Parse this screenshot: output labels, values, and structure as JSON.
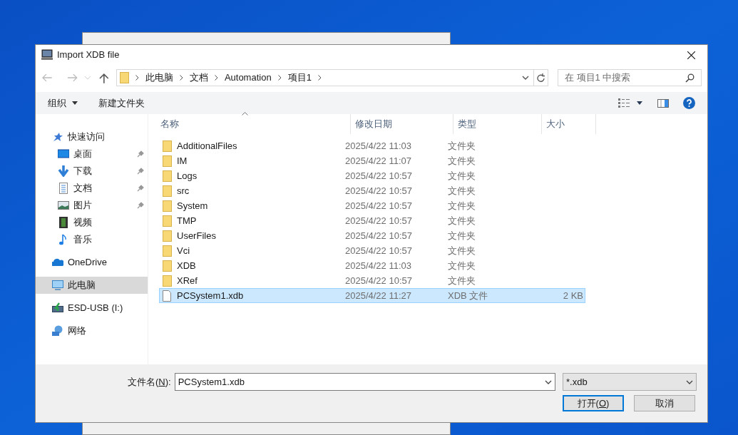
{
  "window": {
    "title": "Import XDB file"
  },
  "address": {
    "segments": [
      "此电脑",
      "文档",
      "Automation",
      "项目1"
    ]
  },
  "search": {
    "placeholder": "在 项目1 中搜索"
  },
  "toolbar": {
    "organize": "组织",
    "new_folder": "新建文件夹"
  },
  "sidebar": {
    "items": [
      {
        "label": "快速访问",
        "kind": "star",
        "pinned": false,
        "selected": false,
        "children": [
          {
            "label": "桌面",
            "kind": "desktop",
            "pinned": true,
            "selected": false
          },
          {
            "label": "下载",
            "kind": "download",
            "pinned": true,
            "selected": false
          },
          {
            "label": "文档",
            "kind": "document",
            "pinned": true,
            "selected": false
          },
          {
            "label": "图片",
            "kind": "pictures",
            "pinned": true,
            "selected": false
          },
          {
            "label": "视频",
            "kind": "video",
            "pinned": false,
            "selected": false
          },
          {
            "label": "音乐",
            "kind": "music",
            "pinned": false,
            "selected": false
          }
        ]
      },
      {
        "label": "OneDrive",
        "kind": "cloud",
        "pinned": false,
        "selected": false
      },
      {
        "label": "此电脑",
        "kind": "computer",
        "pinned": false,
        "selected": true
      },
      {
        "label": "ESD-USB (I:)",
        "kind": "usb",
        "pinned": false,
        "selected": false
      },
      {
        "label": "网络",
        "kind": "network",
        "pinned": false,
        "selected": false
      }
    ]
  },
  "table": {
    "columns": [
      {
        "label": "名称",
        "sorted": true
      },
      {
        "label": "修改日期",
        "sorted": false
      },
      {
        "label": "类型",
        "sorted": false
      },
      {
        "label": "大小",
        "sorted": false
      }
    ],
    "rows": [
      {
        "kind": "folder",
        "name": "AdditionalFiles",
        "date": "2025/4/22 11:03",
        "type": "文件夹",
        "selected": false
      },
      {
        "kind": "folder",
        "name": "IM",
        "date": "2025/4/22 11:07",
        "type": "文件夹",
        "selected": false
      },
      {
        "kind": "folder",
        "name": "Logs",
        "date": "2025/4/22 10:57",
        "type": "文件夹",
        "selected": false
      },
      {
        "kind": "folder",
        "name": "src",
        "date": "2025/4/22 10:57",
        "type": "文件夹",
        "selected": false
      },
      {
        "kind": "folder",
        "name": "System",
        "date": "2025/4/22 10:57",
        "type": "文件夹",
        "selected": false
      },
      {
        "kind": "folder",
        "name": "TMP",
        "date": "2025/4/22 10:57",
        "type": "文件夹",
        "selected": false
      },
      {
        "kind": "folder",
        "name": "UserFiles",
        "date": "2025/4/22 10:57",
        "type": "文件夹",
        "selected": false
      },
      {
        "kind": "folder",
        "name": "Vci",
        "date": "2025/4/22 10:57",
        "type": "文件夹",
        "selected": false
      },
      {
        "kind": "folder",
        "name": "XDB",
        "date": "2025/4/22 11:03",
        "type": "文件夹",
        "selected": false
      },
      {
        "kind": "folder",
        "name": "XRef",
        "date": "2025/4/22 10:57",
        "type": "文件夹",
        "selected": false
      },
      {
        "kind": "file",
        "name": "PCSystem1.xdb",
        "date": "2025/4/22 11:27",
        "type": "XDB 文件",
        "size": "2 KB",
        "selected": true
      }
    ]
  },
  "filename": {
    "label": {
      "prefix": "文件名(",
      "mnemonic": "N",
      "suffix": "):"
    },
    "value": "PCSystem1.xdb"
  },
  "filter": {
    "value": "*.xdb"
  },
  "buttons": [
    {
      "prefix": "打开(",
      "mnemonic": "O",
      "suffix": ")",
      "default": true
    },
    {
      "prefix": "取消",
      "default": false
    }
  ]
}
